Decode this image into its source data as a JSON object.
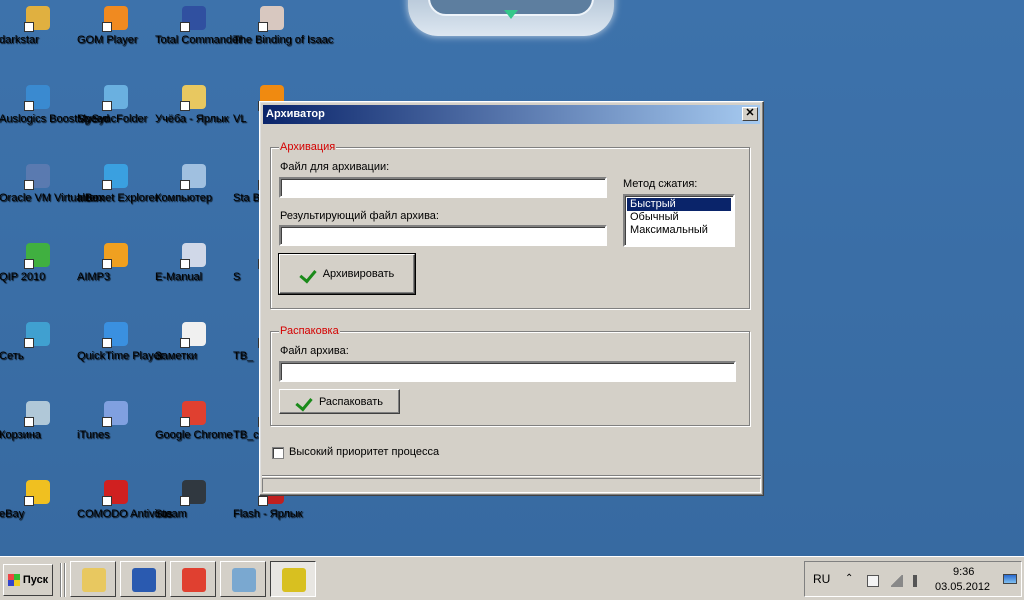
{
  "desktop": {
    "icons": [
      {
        "name": "darkstar",
        "label": "darkstar",
        "color": "#e0b040"
      },
      {
        "name": "gom-player",
        "label": "GOM Player",
        "color": "#f08a20"
      },
      {
        "name": "total-commander",
        "label": "Total Commander",
        "color": "#3050a0"
      },
      {
        "name": "binding-of-isaac",
        "label": "The Binding of Isaac",
        "color": "#d8c8c0"
      },
      {
        "name": "auslogics-boostspeed",
        "label": "Auslogics BoostSpeed",
        "color": "#3a8ad0"
      },
      {
        "name": "mysyncfolder",
        "label": "MySyncFolder",
        "color": "#6ab0e0"
      },
      {
        "name": "ucheba-shortcut",
        "label": "Учёба - Ярлык",
        "color": "#e8c860"
      },
      {
        "name": "vlc",
        "label": "VL",
        "color": "#f08a10"
      },
      {
        "name": "oracle-vm-virtualbox",
        "label": "Oracle VM VirtualBox",
        "color": "#5a7ab0"
      },
      {
        "name": "internet-explorer",
        "label": "Internet Explorer",
        "color": "#3aa0e0"
      },
      {
        "name": "computer",
        "label": "Компьютер",
        "color": "#a0c0e0"
      },
      {
        "name": "steam-broken",
        "label": "Sta Bro",
        "color": "#506070"
      },
      {
        "name": "qip-2010",
        "label": "QIP 2010",
        "color": "#40b040"
      },
      {
        "name": "aimp3",
        "label": "AIMP3",
        "color": "#f0a020"
      },
      {
        "name": "e-manual",
        "label": "E-Manual",
        "color": "#d0d8e8"
      },
      {
        "name": "unknown-s",
        "label": "S",
        "color": "#6080a0"
      },
      {
        "name": "network",
        "label": "Сеть",
        "color": "#40a0d0"
      },
      {
        "name": "quicktime-player",
        "label": "QuickTime Player",
        "color": "#3a90e0"
      },
      {
        "name": "notes",
        "label": "Заметки",
        "color": "#f0f0f0"
      },
      {
        "name": "tb-1",
        "label": "TB_",
        "color": "#6080a0"
      },
      {
        "name": "recycle-bin",
        "label": "Корзина",
        "color": "#b0c8d8"
      },
      {
        "name": "itunes",
        "label": "iTunes",
        "color": "#80a0e0"
      },
      {
        "name": "google-chrome",
        "label": "Google Chrome",
        "color": "#e04030"
      },
      {
        "name": "tb-2",
        "label": "TB_c",
        "color": "#6080a0"
      },
      {
        "name": "ebay",
        "label": "eBay",
        "color": "#f0c020"
      },
      {
        "name": "comodo-antivirus",
        "label": "COMODO Antivirus",
        "color": "#d02020"
      },
      {
        "name": "steam",
        "label": "Steam",
        "color": "#303840"
      },
      {
        "name": "flash-shortcut",
        "label": "Flash - Ярлык",
        "color": "#c02020"
      }
    ]
  },
  "window": {
    "title": "Архиватор",
    "close_glyph": "✕",
    "archive_group": {
      "legend": "Архивация",
      "file_label": "Файл для архивации:",
      "file_value": "",
      "result_label": "Результирующий файл архива:",
      "result_value": "",
      "method_label": "Метод сжатия:",
      "methods": [
        "Быстрый",
        "Обычный",
        "Максимальный"
      ],
      "selected_method": "Быстрый",
      "archive_button": "Архивировать"
    },
    "extract_group": {
      "legend": "Распаковка",
      "archive_label": "Файл архива:",
      "archive_value": "",
      "extract_button": "Распаковать"
    },
    "priority_label": "Высокий приоритет процесса",
    "priority_checked": false
  },
  "taskbar": {
    "start_label": "Пуск",
    "apps": [
      {
        "name": "explorer",
        "color": "#e8c860",
        "active": false
      },
      {
        "name": "word",
        "color": "#2a5ab0",
        "active": false
      },
      {
        "name": "chrome",
        "color": "#e04030",
        "active": false
      },
      {
        "name": "notepad",
        "color": "#7aa8d0",
        "active": false
      },
      {
        "name": "archiver",
        "color": "#d8c020",
        "active": true
      }
    ],
    "tray": {
      "language": "RU",
      "time": "9:36",
      "date": "03.05.2012"
    }
  }
}
